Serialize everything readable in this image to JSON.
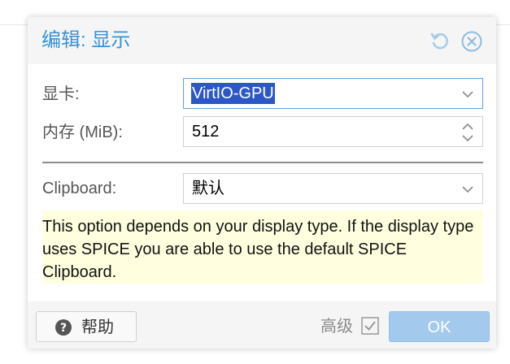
{
  "dialog": {
    "title": "编辑: 显示"
  },
  "fields": {
    "graphics_card": {
      "label": "显卡:",
      "value": "VirtIO-GPU"
    },
    "memory": {
      "label": "内存 (MiB):",
      "value": "512"
    },
    "clipboard": {
      "label": "Clipboard:",
      "value": "默认"
    }
  },
  "notice": {
    "text": "This option depends on your display type. If the display type uses SPICE you are able to use the default SPICE Clipboard."
  },
  "footer": {
    "help_label": "帮助",
    "advanced_label": "高级",
    "ok_label": "OK"
  },
  "colors": {
    "title": "#3892d4",
    "ok_button": "#a3c9ec",
    "notice_bg": "#ffffe0",
    "selection": "#2c58c7"
  }
}
